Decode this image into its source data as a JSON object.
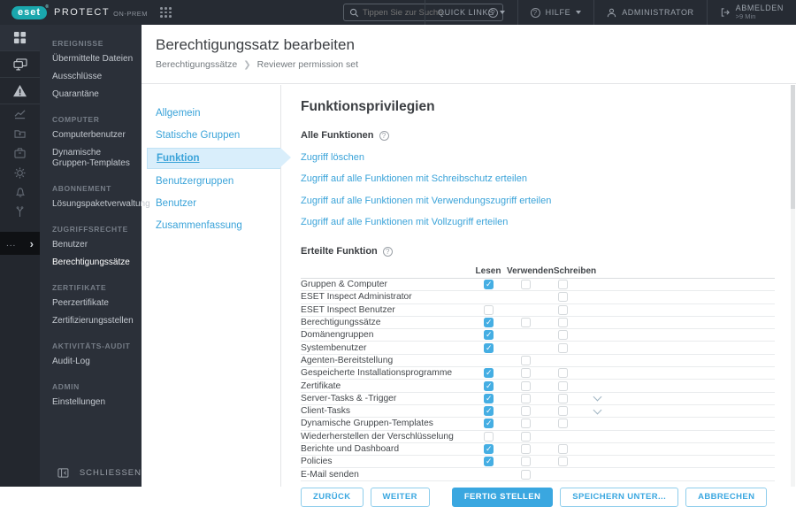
{
  "colors": {
    "accent_blue": "#3aa7e0",
    "link_blue": "#3aa3d9",
    "topbar_bg": "#262b33",
    "rail_bg": "#23272e",
    "menu_bg": "#2b3039",
    "brand_teal": "#1aa7ad",
    "checked_checkbox": "#45aee3",
    "wizard_active_bg": "#d9eefb"
  },
  "topbar": {
    "logo": "eset",
    "product": "PROTECT",
    "edition": "ON-PREM",
    "search": {
      "placeholder": "Tippen Sie zur Suche..."
    },
    "quick_links": "QUICK LINKS",
    "help": "HILFE",
    "user": "ADMINISTRATOR",
    "logout": "ABMELDEN",
    "logout_sub": ">9 Min"
  },
  "rail": {
    "icons": [
      {
        "name": "dashboard",
        "bright": true
      },
      {
        "name": "computers",
        "bright": true
      },
      {
        "name": "detections-warning",
        "bright": true
      },
      {
        "name": "reports-chart",
        "bright": false
      },
      {
        "name": "submitted-files-folder",
        "bright": false
      },
      {
        "name": "installers-box",
        "bright": false
      },
      {
        "name": "settings-gear",
        "bright": false
      },
      {
        "name": "notifications-bell",
        "bright": false
      },
      {
        "name": "status-overview",
        "bright": false
      }
    ],
    "more": "...",
    "expand": "›"
  },
  "sidebar": {
    "sections": [
      {
        "header": "EREIGNISSE",
        "items": [
          "Übermittelte Dateien",
          "Ausschlüsse",
          "Quarantäne"
        ]
      },
      {
        "header": "COMPUTER",
        "items": [
          "Computerbenutzer",
          "Dynamische Gruppen-Templates"
        ]
      },
      {
        "header": "ABONNEMENT",
        "items": [
          "Lösungspaketverwaltung"
        ]
      },
      {
        "header": "ZUGRIFFSRECHTE",
        "items": [
          "Benutzer",
          "Berechtigungssätze"
        ]
      },
      {
        "header": "ZERTIFIKATE",
        "items": [
          "Peerzertifikate",
          "Zertifizierungsstellen"
        ]
      },
      {
        "header": "AKTIVITÄTS-AUDIT",
        "items": [
          "Audit-Log"
        ]
      },
      {
        "header": "ADMIN",
        "items": [
          "Einstellungen"
        ]
      }
    ],
    "selected": "Berechtigungssätze",
    "collapse_label": "SCHLIESSEN"
  },
  "page": {
    "title": "Berechtigungssatz bearbeiten",
    "breadcrumb": {
      "parent": "Berechtigungssätze",
      "current": "Reviewer permission set"
    }
  },
  "wizard": {
    "steps": [
      "Allgemein",
      "Statische Gruppen",
      "Funktion",
      "Benutzergruppen",
      "Benutzer",
      "Zusammenfassung"
    ],
    "active": "Funktion"
  },
  "content": {
    "heading": "Funktionsprivilegien",
    "all_functions_label": "Alle Funktionen",
    "links": [
      "Zugriff löschen",
      "Zugriff auf alle Funktionen mit Schreibschutz erteilen",
      "Zugriff auf alle Funktionen mit Verwendungszugriff erteilen",
      "Zugriff auf alle Funktionen mit Vollzugriff erteilen"
    ],
    "granted_label": "Erteilte Funktion",
    "table": {
      "columns": [
        "Lesen",
        "Verwenden",
        "Schreiben"
      ],
      "rows": [
        {
          "label": "Gruppen & Computer",
          "lesen": "checked",
          "verwenden": "unchecked",
          "schreiben": "unchecked",
          "expandable": false
        },
        {
          "label": "ESET Inspect Administrator",
          "lesen": null,
          "verwenden": null,
          "schreiben": "unchecked",
          "expandable": false
        },
        {
          "label": "ESET Inspect Benutzer",
          "lesen": "unchecked",
          "verwenden": null,
          "schreiben": "unchecked",
          "expandable": false
        },
        {
          "label": "Berechtigungssätze",
          "lesen": "checked",
          "verwenden": "unchecked",
          "schreiben": "unchecked",
          "expandable": false
        },
        {
          "label": "Domänengruppen",
          "lesen": "checked",
          "verwenden": null,
          "schreiben": "unchecked",
          "expandable": false
        },
        {
          "label": "Systembenutzer",
          "lesen": "checked",
          "verwenden": null,
          "schreiben": "unchecked",
          "expandable": false
        },
        {
          "label": "Agenten-Bereitstellung",
          "lesen": null,
          "verwenden": "unchecked",
          "schreiben": null,
          "expandable": false
        },
        {
          "label": "Gespeicherte Installationsprogramme",
          "lesen": "checked",
          "verwenden": "unchecked",
          "schreiben": "unchecked",
          "expandable": false
        },
        {
          "label": "Zertifikate",
          "lesen": "checked",
          "verwenden": "unchecked",
          "schreiben": "unchecked",
          "expandable": false
        },
        {
          "label": "Server-Tasks & -Trigger",
          "lesen": "checked",
          "verwenden": "unchecked",
          "schreiben": "unchecked",
          "expandable": true
        },
        {
          "label": "Client-Tasks",
          "lesen": "checked",
          "verwenden": "unchecked",
          "schreiben": "unchecked",
          "expandable": true
        },
        {
          "label": "Dynamische Gruppen-Templates",
          "lesen": "checked",
          "verwenden": "unchecked",
          "schreiben": "unchecked",
          "expandable": false
        },
        {
          "label": "Wiederherstellen der Verschlüsselung",
          "lesen": "unchecked",
          "verwenden": "unchecked",
          "schreiben": null,
          "expandable": false
        },
        {
          "label": "Berichte und Dashboard",
          "lesen": "checked",
          "verwenden": "unchecked",
          "schreiben": "unchecked",
          "expandable": false
        },
        {
          "label": "Policies",
          "lesen": "checked",
          "verwenden": "unchecked",
          "schreiben": "unchecked",
          "expandable": false
        },
        {
          "label": "E-Mail senden",
          "lesen": null,
          "verwenden": "unchecked",
          "schreiben": null,
          "expandable": false
        }
      ]
    },
    "buttons": [
      {
        "label": "ZURÜCK",
        "primary": false,
        "gap": false
      },
      {
        "label": "WEITER",
        "primary": false,
        "gap": false
      },
      {
        "label": "FERTIG STELLEN",
        "primary": true,
        "gap": true
      },
      {
        "label": "SPEICHERN UNTER...",
        "primary": false,
        "gap": false
      },
      {
        "label": "ABBRECHEN",
        "primary": false,
        "gap": false
      }
    ]
  }
}
